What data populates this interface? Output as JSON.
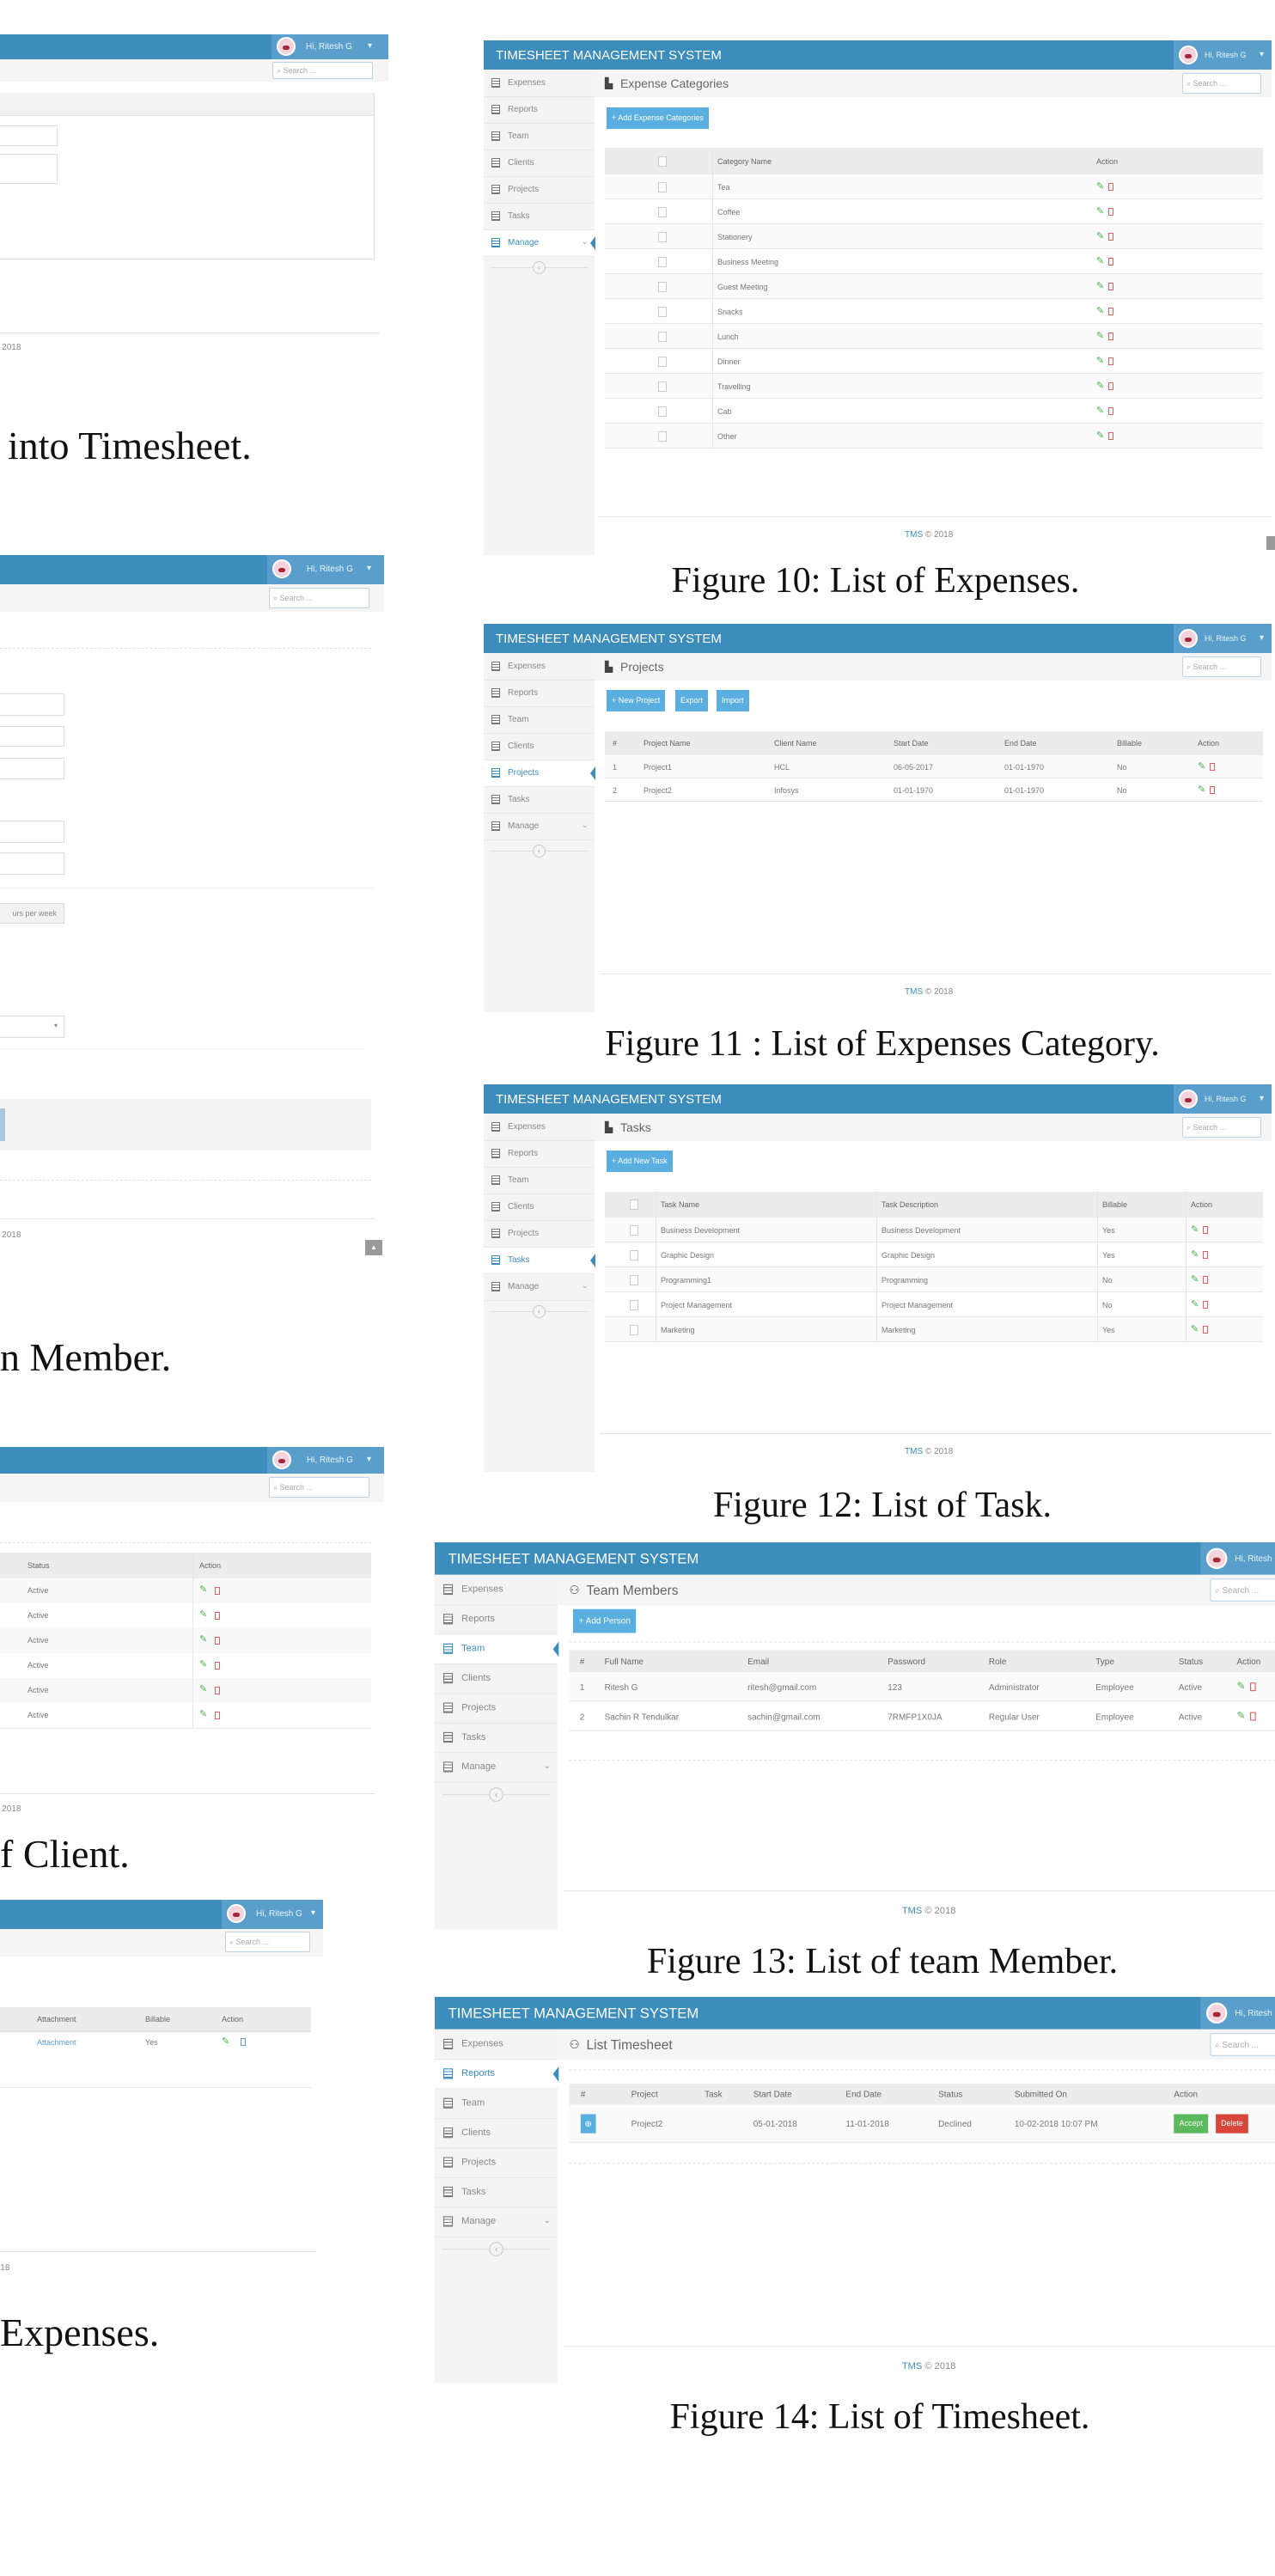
{
  "app": {
    "title": "TIMESHEET MANAGEMENT SYSTEM",
    "user": "Hi, Ritesh G",
    "search_placeholder": "Search ...",
    "footer_brand": "TMS",
    "footer_copy": "© 2018",
    "colors": {
      "header": "#3c8dbc",
      "button": "#5aaee0",
      "edit": "#4caf50",
      "delete": "#e06060",
      "accept": "#5cb85c",
      "decline": "#d9463b"
    }
  },
  "sidebar": [
    {
      "label": "Expenses",
      "icon": "calendar-icon"
    },
    {
      "label": "Reports",
      "icon": "table-icon"
    },
    {
      "label": "Team",
      "icon": "users-icon"
    },
    {
      "label": "Clients",
      "icon": "table-icon"
    },
    {
      "label": "Projects",
      "icon": "table-icon"
    },
    {
      "label": "Tasks",
      "icon": "table-icon"
    },
    {
      "label": "Manage",
      "icon": "calendar-icon"
    }
  ],
  "figures": [
    {
      "title": "Expense Categories",
      "active": 6,
      "buttons": [
        "+ Add Expense Categories"
      ],
      "checkbox": true,
      "columns": [
        "Category Name",
        "Action"
      ],
      "rows": [
        [
          "Tea"
        ],
        [
          "Coffee"
        ],
        [
          "Stationery"
        ],
        [
          "Business Meeting"
        ],
        [
          "Guest Meeting"
        ],
        [
          "Snacks"
        ],
        [
          "Lunch"
        ],
        [
          "Dinner"
        ],
        [
          "Travelling"
        ],
        [
          "Cab"
        ],
        [
          "Other"
        ]
      ],
      "caption": "Figure 10: List of Expenses."
    },
    {
      "title": "Projects",
      "active": 4,
      "buttons": [
        "+ New Project",
        "Export",
        "Import"
      ],
      "checkbox": false,
      "columns": [
        "#",
        "Project Name",
        "Client Name",
        "Start Date",
        "End Date",
        "Billable",
        "Action"
      ],
      "rows": [
        [
          "1",
          "Project1",
          "HCL",
          "06-05-2017",
          "01-01-1970",
          "No"
        ],
        [
          "2",
          "Project2",
          "Infosys",
          "01-01-1970",
          "01-01-1970",
          "No"
        ]
      ],
      "caption": "Figure 11 : List of Expenses Category."
    },
    {
      "title": "Tasks",
      "active": 5,
      "buttons": [
        "+ Add New Task"
      ],
      "checkbox": true,
      "columns": [
        "Task Name",
        "Task Description",
        "Billable",
        "Action"
      ],
      "rows": [
        [
          "Business Development",
          "Business Development",
          "Yes"
        ],
        [
          "Graphic Design",
          "Graphic Design",
          "Yes"
        ],
        [
          "Programming1",
          "Programming",
          "No"
        ],
        [
          "Project Management",
          "Project Management",
          "No"
        ],
        [
          "Marketing",
          "Marketing",
          "Yes"
        ]
      ],
      "caption": "Figure 12: List of Task."
    },
    {
      "title": "Team Members",
      "active": 2,
      "buttons": [
        "+ Add Person"
      ],
      "checkbox": false,
      "columns": [
        "#",
        "Full Name",
        "Email",
        "Password",
        "Role",
        "Type",
        "Status",
        "Action"
      ],
      "rows": [
        [
          "1",
          "Ritesh G",
          "ritesh@gmail.com",
          "123",
          "Administrator",
          "Employee",
          "Active"
        ],
        [
          "2",
          "Sachin R Tendulkar",
          "sachin@gmail.com",
          "7RMFP1X0JA",
          "Regular User",
          "Employee",
          "Active"
        ]
      ],
      "caption": "Figure 13: List of team Member."
    },
    {
      "title": "List Timesheet",
      "active": 1,
      "buttons": [],
      "checkbox": false,
      "columns": [
        "#",
        "Project",
        "Task",
        "Start Date",
        "End Date",
        "Status",
        "Submitted On",
        "Action"
      ],
      "rows": [
        [
          "1",
          "Project2",
          "",
          "05-01-2018",
          "11-01-2018",
          "Declined",
          "10-02-2018 10:07 PM"
        ]
      ],
      "row_actions": [
        "Accept",
        "Delete"
      ],
      "caption": "Figure 14: List of Timesheet."
    }
  ],
  "left_figures": {
    "timesheet_add": {
      "caption": "into Timesheet."
    },
    "member_add": {
      "hours_button": "urs per week",
      "caption": "n Member."
    },
    "clients": {
      "columns": [
        "Status",
        "Action"
      ],
      "rows": [
        "Active",
        "Active",
        "Active",
        "Active",
        "Active",
        "Active"
      ],
      "caption": "f Client."
    },
    "expenses": {
      "columns": [
        "Attachment",
        "Billable",
        "Action"
      ],
      "row": [
        "Attachment",
        "Yes"
      ],
      "caption": "Expenses."
    }
  }
}
